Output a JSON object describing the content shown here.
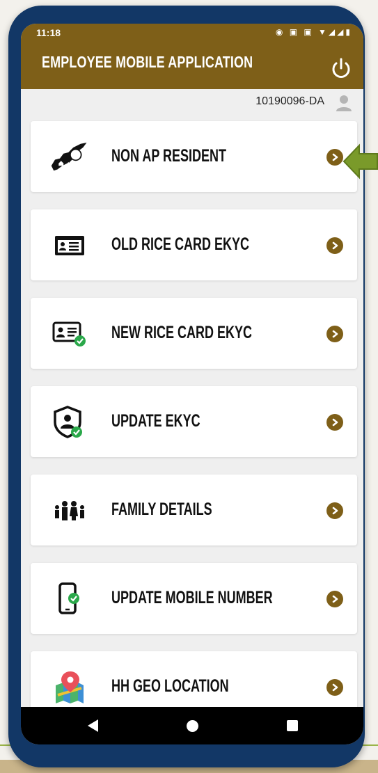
{
  "status_bar": {
    "time": "11:18",
    "icons": "◉ ▣ ▣ ▼◢◢▮"
  },
  "header": {
    "title": "EMPLOYEE MOBILE APPLICATION"
  },
  "user": {
    "id": "10190096-DA"
  },
  "menu": [
    {
      "label": "NON AP RESIDENT",
      "icon": "ap-map-icon"
    },
    {
      "label": "OLD RICE CARD EKYC",
      "icon": "id-card-icon"
    },
    {
      "label": "NEW RICE CARD EKYC",
      "icon": "id-card-check-icon"
    },
    {
      "label": "UPDATE EKYC",
      "icon": "shield-user-icon"
    },
    {
      "label": "FAMILY DETAILS",
      "icon": "family-icon"
    },
    {
      "label": "UPDATE MOBILE NUMBER",
      "icon": "mobile-check-icon"
    },
    {
      "label": "HH GEO LOCATION",
      "icon": "map-pin-icon"
    }
  ],
  "colors": {
    "frame": "#123766",
    "accent": "#7e5f18",
    "callout": "#7a9a2a"
  }
}
